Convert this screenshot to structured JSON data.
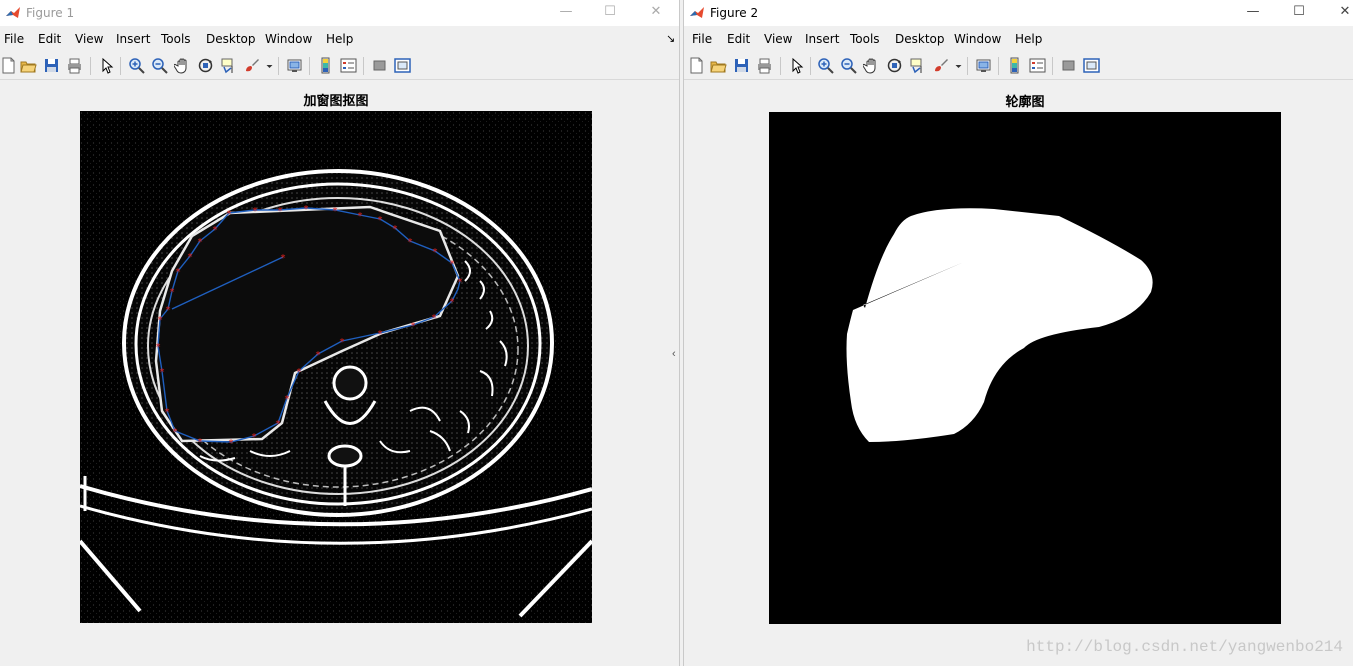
{
  "menu_items": [
    "File",
    "Edit",
    "View",
    "Insert",
    "Tools",
    "Desktop",
    "Window",
    "Help"
  ],
  "figure1": {
    "title": "Figure 1",
    "plot_title": "加窗图抠图",
    "window_buttons": {
      "minimize": "—",
      "maximize": "☐",
      "close": "✕"
    },
    "toolbar_icons": [
      "new-figure-icon",
      "open-file-icon",
      "save-icon",
      "print-icon",
      "pointer-icon",
      "zoom-in-icon",
      "zoom-out-icon",
      "pan-icon",
      "rotate-3d-icon",
      "data-cursor-icon",
      "brush-icon",
      "link-plot-icon",
      "colorbar-icon",
      "legend-icon",
      "hide-plot-tools-icon",
      "show-plot-tools-icon"
    ],
    "dock_arrow": "↘"
  },
  "figure2": {
    "title": "Figure 2",
    "plot_title": "轮廓图",
    "window_buttons": {
      "minimize": "—",
      "maximize": "☐",
      "close": "✕"
    }
  },
  "watermark": "http://blog.csdn.net/yangwenbo214",
  "colors": {
    "accent": "#e64a2e",
    "contour": "#1f5fbf",
    "marker": "#e0201c"
  }
}
